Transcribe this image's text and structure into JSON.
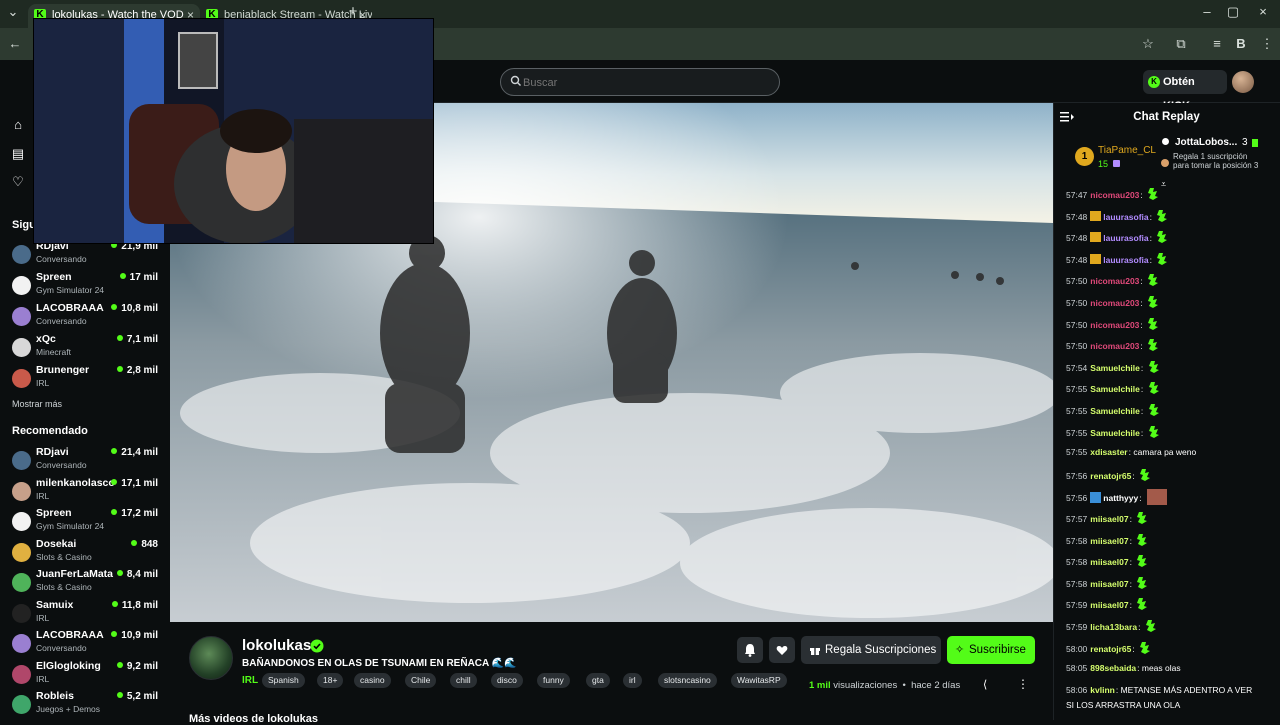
{
  "browser": {
    "tabs": [
      {
        "title": "lokolukas - Watch the VOD"
      },
      {
        "title": "benjablack Stream - Watch Live"
      }
    ],
    "new_tab": "+"
  },
  "header": {
    "search_placeholder": "Buscar",
    "get_kicks": "Obtén KICKs"
  },
  "sidebar": {
    "following_title": "Siguiendo",
    "following": [
      {
        "name": "RDjavi",
        "category": "Conversando",
        "viewers": "21,9 mil",
        "color": "#4a6b8a"
      },
      {
        "name": "Spreen",
        "category": "Gym Simulator 24",
        "viewers": "17 mil",
        "color": "#f2f2f2"
      },
      {
        "name": "LACOBRAAA",
        "category": "Conversando",
        "viewers": "10,8 mil",
        "color": "#9a7fd1"
      },
      {
        "name": "xQc",
        "category": "Minecraft",
        "viewers": "7,1 mil",
        "color": "#d8d8d8"
      },
      {
        "name": "Brunenger",
        "category": "IRL",
        "viewers": "2,8 mil",
        "color": "#c95a4a"
      }
    ],
    "show_more": "Mostrar más",
    "recommended_title": "Recomendado",
    "recommended": [
      {
        "name": "RDjavi",
        "category": "Conversando",
        "viewers": "21,4 mil",
        "color": "#4a6b8a"
      },
      {
        "name": "milenkanolasco",
        "category": "IRL",
        "viewers": "17,1 mil",
        "color": "#c7a08a"
      },
      {
        "name": "Spreen",
        "category": "Gym Simulator 24",
        "viewers": "17,2 mil",
        "color": "#f2f2f2"
      },
      {
        "name": "Dosekai",
        "category": "Slots & Casino",
        "viewers": "848",
        "color": "#e0b040"
      },
      {
        "name": "JuanFerLaMata",
        "category": "Slots & Casino",
        "viewers": "8,4 mil",
        "color": "#4fb35a"
      },
      {
        "name": "Samuix",
        "category": "IRL",
        "viewers": "11,8 mil",
        "color": "#222222"
      },
      {
        "name": "LACOBRAAA",
        "category": "Conversando",
        "viewers": "10,9 mil",
        "color": "#9a7fd1"
      },
      {
        "name": "ElGlogloking",
        "category": "IRL",
        "viewers": "9,2 mil",
        "color": "#b0476a"
      },
      {
        "name": "Robleis",
        "category": "Juegos + Demos",
        "viewers": "5,2 mil",
        "color": "#3fa66a"
      }
    ]
  },
  "video": {
    "channel_name": "lokolukas",
    "title": "BAÑANDONOS EN OLAS DE TSUNAMI EN REÑACA 🌊🌊",
    "category": "IRL",
    "tags": [
      "Spanish",
      "18+",
      "casino",
      "Chile",
      "chill",
      "disco",
      "funny",
      "gta",
      "irl",
      "slotsncasino",
      "WawitasRP"
    ],
    "gift_subs": "Regala Suscripciones",
    "subscribe": "Suscribirse",
    "views_count": "1 mil",
    "views_label": "visualizaciones",
    "age": "hace 2 días",
    "more_videos": "Más videos de lokolukas"
  },
  "chat": {
    "title": "Chat Replay",
    "leader": {
      "rank": "1",
      "name": "TiaPame_CL",
      "count": "15"
    },
    "gift_promo": {
      "name": "JottaLobos...",
      "count": "3",
      "text": "Regala 1 suscripción para tomar la posición 3"
    },
    "messages": [
      {
        "ts": "57:47",
        "user": "nicomau203",
        "color": "#e0497a",
        "text": "",
        "emote": true
      },
      {
        "ts": "57:48",
        "user": "lauurasofia",
        "color": "#b28cff",
        "text": "",
        "emote": true,
        "badge": "crown"
      },
      {
        "ts": "57:48",
        "user": "lauurasofia",
        "color": "#b28cff",
        "text": "",
        "emote": true,
        "badge": "crown"
      },
      {
        "ts": "57:48",
        "user": "lauurasofia",
        "color": "#b28cff",
        "text": "",
        "emote": true,
        "badge": "crown"
      },
      {
        "ts": "57:50",
        "user": "nicomau203",
        "color": "#e0497a",
        "text": "",
        "emote": true
      },
      {
        "ts": "57:50",
        "user": "nicomau203",
        "color": "#e0497a",
        "text": "",
        "emote": true
      },
      {
        "ts": "57:50",
        "user": "nicomau203",
        "color": "#e0497a",
        "text": "",
        "emote": true
      },
      {
        "ts": "57:50",
        "user": "nicomau203",
        "color": "#e0497a",
        "text": "",
        "emote": true
      },
      {
        "ts": "57:54",
        "user": "Samuelchile",
        "color": "#d6ff6e",
        "text": "",
        "emote": true
      },
      {
        "ts": "57:55",
        "user": "Samuelchile",
        "color": "#d6ff6e",
        "text": "",
        "emote": true
      },
      {
        "ts": "57:55",
        "user": "Samuelchile",
        "color": "#d6ff6e",
        "text": "",
        "emote": true
      },
      {
        "ts": "57:55",
        "user": "Samuelchile",
        "color": "#d6ff6e",
        "text": "",
        "emote": true
      },
      {
        "ts": "57:55",
        "user": "xdisaster",
        "color": "#d6ff6e",
        "text": "camara pa weno",
        "emote": false
      },
      {
        "ts": "57:56",
        "user": "renatojr65",
        "color": "#d6ff6e",
        "text": "",
        "emote": true
      },
      {
        "ts": "57:56",
        "user": "natthyyy",
        "color": "#ffffff",
        "text": "",
        "emote": false,
        "badge": "blue",
        "pic": true
      },
      {
        "ts": "57:57",
        "user": "miisael07",
        "color": "#d6ff6e",
        "text": "",
        "emote": true
      },
      {
        "ts": "57:58",
        "user": "miisael07",
        "color": "#d6ff6e",
        "text": "",
        "emote": true
      },
      {
        "ts": "57:58",
        "user": "miisael07",
        "color": "#d6ff6e",
        "text": "",
        "emote": true
      },
      {
        "ts": "57:58",
        "user": "miisael07",
        "color": "#d6ff6e",
        "text": "",
        "emote": true
      },
      {
        "ts": "57:59",
        "user": "miisael07",
        "color": "#d6ff6e",
        "text": "",
        "emote": true
      },
      {
        "ts": "57:59",
        "user": "licha13bara",
        "color": "#d6ff6e",
        "text": "",
        "emote": true
      },
      {
        "ts": "58:00",
        "user": "renatojr65",
        "color": "#d6ff6e",
        "text": "",
        "emote": true
      },
      {
        "ts": "58:05",
        "user": "898sebaida",
        "color": "#d6ff6e",
        "text": "meas olas",
        "emote": false
      },
      {
        "ts": "58:06",
        "user": "kvlinn",
        "color": "#d6ff6e",
        "text": "METANSE MÁS ADENTRO A VER",
        "emote": false
      }
    ],
    "last_line": "SI LOS ARRASTRA UNA OLA"
  },
  "colors": {
    "accent": "#53fc18",
    "background": "#0b0e0f",
    "surface": "#2a2f33"
  }
}
